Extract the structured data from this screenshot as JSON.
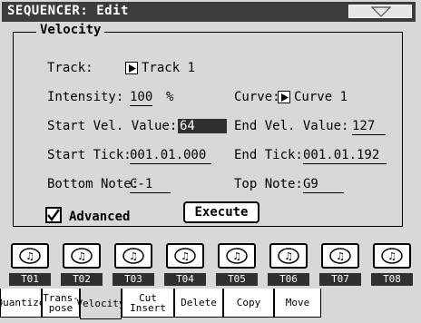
{
  "window": {
    "title": "SEQUENCER: Edit"
  },
  "panel": {
    "title": "Velocity",
    "track_label": "Track:",
    "track_value": "Track 1",
    "intensity_label": "Intensity:",
    "intensity_value": "100",
    "intensity_unit": "%",
    "curve_label": "Curve:",
    "curve_value": "Curve 1",
    "start_vel_label": "Start Vel. Value:",
    "start_vel_value": "64",
    "end_vel_label": "End Vel. Value:",
    "end_vel_value": "127",
    "start_tick_label": "Start Tick:",
    "start_tick_value": "001.01.000",
    "end_tick_label": "End Tick:",
    "end_tick_value": "001.01.192",
    "bottom_note_label": "Bottom Note:",
    "bottom_note_value": "C-1",
    "top_note_label": "Top Note:",
    "top_note_value": "G9",
    "advanced_label": "Advanced",
    "advanced_checked": true,
    "execute_label": "Execute"
  },
  "tracks": [
    "T01",
    "T02",
    "T03",
    "T04",
    "T05",
    "T06",
    "T07",
    "T08"
  ],
  "tabs": [
    {
      "label": "Quantize",
      "active": false
    },
    {
      "label": "Trans-\npose",
      "active": false
    },
    {
      "label": "Velocity",
      "active": true
    },
    {
      "label": "Cut\nInsert",
      "active": false
    },
    {
      "label": "Delete",
      "active": false
    },
    {
      "label": "Copy",
      "active": false
    },
    {
      "label": "Move",
      "active": false
    }
  ],
  "icons": {
    "menu": "triangle-down-icon",
    "selector": "play-arrow-icon",
    "track": "midi-notes-icon",
    "check": "checkmark-icon"
  },
  "colors": {
    "background": "#d8d8d8",
    "titlebar": "#3c3c3c",
    "highlight": "#303030"
  }
}
